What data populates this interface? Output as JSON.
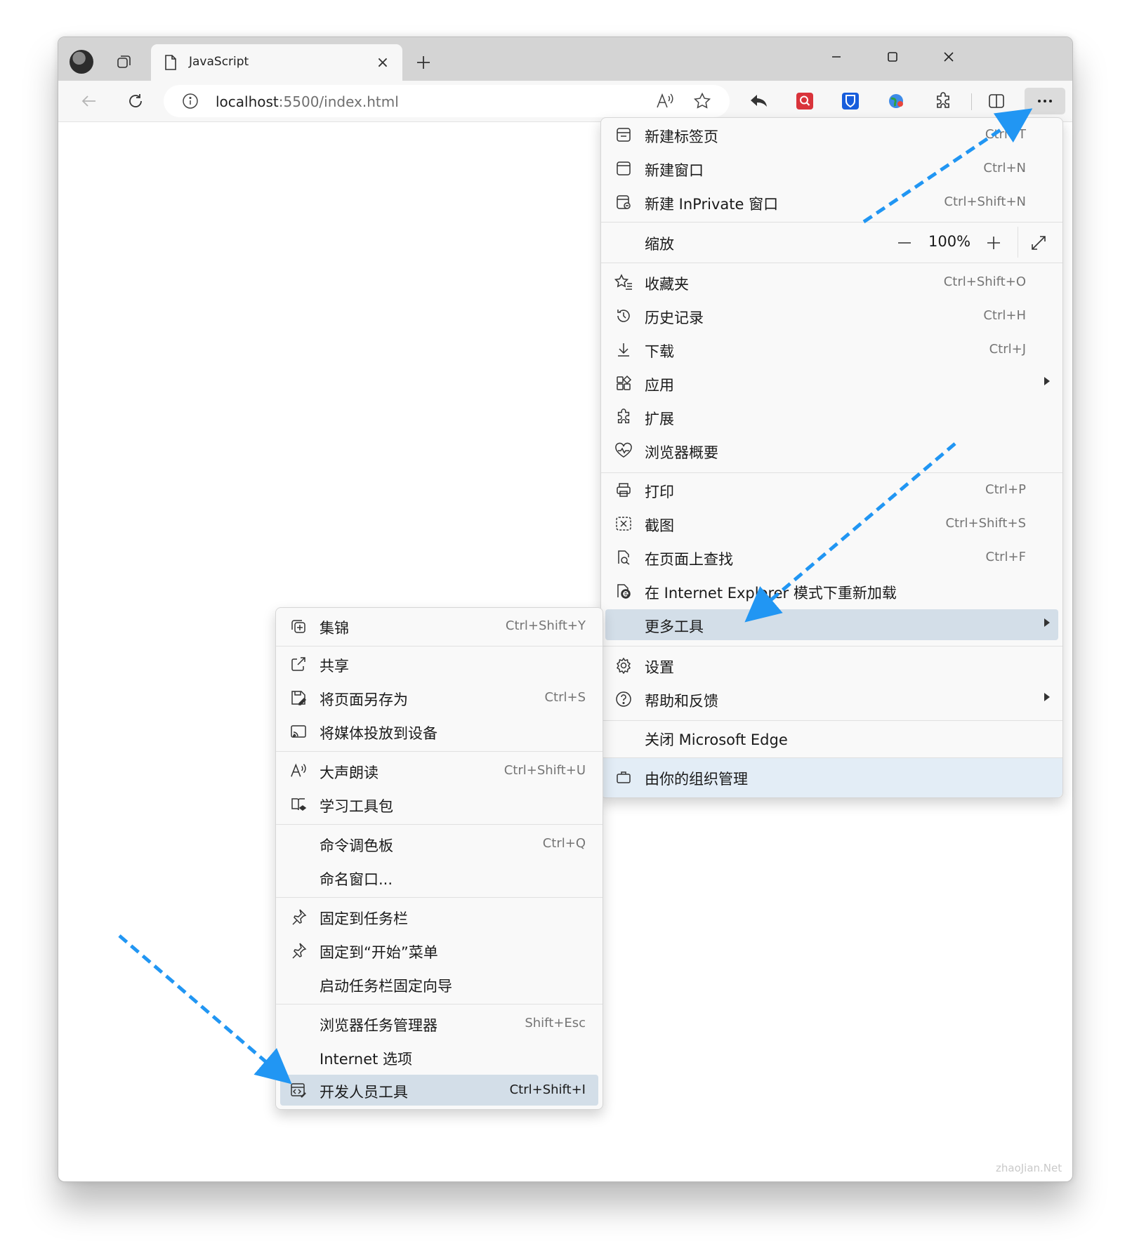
{
  "tab": {
    "title": "JavaScript",
    "close": "×"
  },
  "address": {
    "host": "localhost",
    "rest": ":5500/index.html"
  },
  "colors": {
    "accent_arrow": "#2196f3",
    "highlight": "#d3dee8",
    "managed": "#e3edf6",
    "extension_red": "#d9343b",
    "extension_blue": "#175ddc"
  },
  "icons": {
    "toolbar": [
      "back-icon",
      "refresh-icon",
      "info-icon",
      "read-aloud-icon",
      "favorite-star-icon",
      "share-back-icon",
      "search-extension-icon",
      "bitwarden-shield-icon",
      "globe-extension-icon",
      "extensions-puzzle-icon",
      "split-screen-icon",
      "more-dots-icon"
    ]
  },
  "main_menu": {
    "new_tab": {
      "label": "新建标签页",
      "shortcut": "Ctrl+T"
    },
    "new_window": {
      "label": "新建窗口",
      "shortcut": "Ctrl+N"
    },
    "new_inprivate": {
      "label": "新建 InPrivate 窗口",
      "shortcut": "Ctrl+Shift+N"
    },
    "zoom": {
      "label": "缩放",
      "minus": "—",
      "value": "100%",
      "plus": "+"
    },
    "favorites": {
      "label": "收藏夹",
      "shortcut": "Ctrl+Shift+O"
    },
    "history": {
      "label": "历史记录",
      "shortcut": "Ctrl+H"
    },
    "downloads": {
      "label": "下载",
      "shortcut": "Ctrl+J"
    },
    "apps": {
      "label": "应用"
    },
    "extensions": {
      "label": "扩展"
    },
    "essentials": {
      "label": "浏览器概要"
    },
    "print": {
      "label": "打印",
      "shortcut": "Ctrl+P"
    },
    "screenshot": {
      "label": "截图",
      "shortcut": "Ctrl+Shift+S"
    },
    "find": {
      "label": "在页面上查找",
      "shortcut": "Ctrl+F"
    },
    "ie_mode": {
      "label": "在 Internet Explorer 模式下重新加载"
    },
    "more_tools": {
      "label": "更多工具"
    },
    "settings": {
      "label": "设置"
    },
    "help": {
      "label": "帮助和反馈"
    },
    "close_edge": {
      "label": "关闭 Microsoft Edge"
    },
    "managed": {
      "label": "由你的组织管理"
    }
  },
  "sub_menu": {
    "collections": {
      "label": "集锦",
      "shortcut": "Ctrl+Shift+Y"
    },
    "share": {
      "label": "共享"
    },
    "save_as": {
      "label": "将页面另存为",
      "shortcut": "Ctrl+S"
    },
    "cast": {
      "label": "将媒体投放到设备"
    },
    "read_aloud": {
      "label": "大声朗读",
      "shortcut": "Ctrl+Shift+U"
    },
    "learning_tools": {
      "label": "学习工具包"
    },
    "command_palette": {
      "label": "命令调色板",
      "shortcut": "Ctrl+Q"
    },
    "name_window": {
      "label": "命名窗口..."
    },
    "pin_taskbar": {
      "label": "固定到任务栏"
    },
    "pin_start": {
      "label": "固定到“开始”菜单"
    },
    "pin_wizard": {
      "label": "启动任务栏固定向导"
    },
    "task_manager": {
      "label": "浏览器任务管理器",
      "shortcut": "Shift+Esc"
    },
    "internet_options": {
      "label": "Internet 选项"
    },
    "devtools": {
      "label": "开发人员工具",
      "shortcut": "Ctrl+Shift+I"
    }
  },
  "watermark": "zhaoJian.Net"
}
